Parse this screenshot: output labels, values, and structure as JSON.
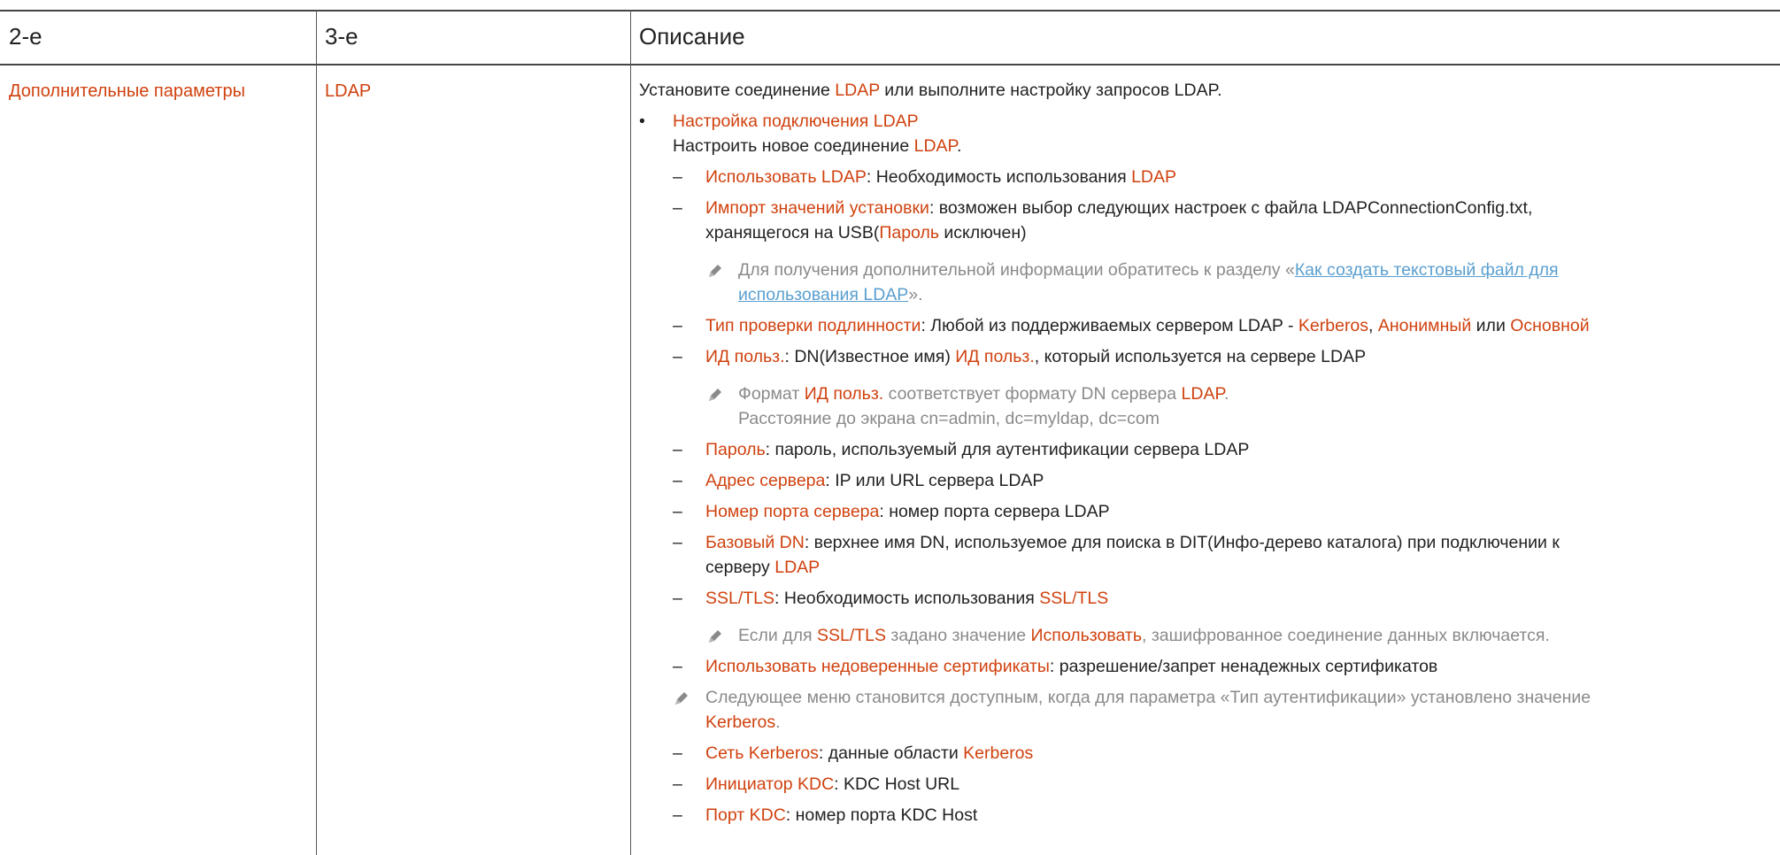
{
  "header": {
    "col2": "2-е",
    "col3": "3-е",
    "col4": "Описание"
  },
  "row": {
    "level2": "Дополнительные параметры",
    "level3": "LDAP",
    "intro": {
      "a": "Установите соединение ",
      "b": "LDAP",
      "c": " или выполните настройку запросов LDAP."
    },
    "bullet": {
      "glyph": "•",
      "title": "Настройка подключения LDAP",
      "sub_a": "Настроить новое соединение ",
      "sub_b": "LDAP",
      "sub_c": "."
    },
    "dash": "–",
    "items": {
      "use_ldap": {
        "a": "Использовать LDAP",
        "b": ": Необходимость использования ",
        "c": "LDAP"
      },
      "import": {
        "a": "Импорт значений установки",
        "b": ": возможен выбор следующих настроек с файла LDAPConnectionConfig.txt,",
        "c": "хранящегося на USB(",
        "d": "Пароль",
        "e": " исключен)"
      },
      "note_import": {
        "a": "Для получения дополнительной информации обратитесь к разделу «",
        "link1": "Как создать текстовый файл для",
        "link2": "использования LDAP",
        "c": "»."
      },
      "auth_type": {
        "a": "Тип проверки подлинности",
        "b": ": Любой из поддерживаемых сервером LDAP - ",
        "c": "Kerberos",
        "d": ", ",
        "e": "Анонимный",
        "f": " или ",
        "g": "Основной"
      },
      "user_id": {
        "a": "ИД польз.",
        "b": ": DN(Известное имя) ",
        "c": "ИД польз.",
        "d": ", который используется на сервере LDAP"
      },
      "note_user": {
        "a": "Формат ",
        "b": "ИД польз.",
        "c": " соответствует формату DN сервера ",
        "d": "LDAP",
        "e": ".",
        "line2": "Расстояние до экрана cn=admin, dc=myldap, dc=com"
      },
      "password": {
        "a": "Пароль",
        "b": ": пароль, используемый для аутентификации сервера LDAP"
      },
      "server_addr": {
        "a": "Адрес сервера",
        "b": ": IP или URL сервера LDAP"
      },
      "server_port": {
        "a": "Номер порта сервера",
        "b": ": номер порта сервера LDAP"
      },
      "base_dn": {
        "a": "Базовый DN",
        "b": ": верхнее имя DN, используемое для поиска в DIT(Инфо-дерево каталога) при подключении к",
        "c": "серверу ",
        "d": "LDAP"
      },
      "ssl": {
        "a": "SSL/TLS",
        "b": ": Необходимость использования ",
        "c": "SSL/TLS"
      },
      "note_ssl": {
        "a": "Если для ",
        "b": "SSL/TLS",
        "c": " задано значение ",
        "d": "Использовать",
        "e": ", зашифрованное соединение данных включается."
      },
      "untrusted": {
        "a": "Использовать недоверенные сертификаты",
        "b": ": разрешение/запрет ненадежных сертификатов"
      },
      "note_kerberos": {
        "a": "Следующее меню становится доступным, когда для параметра «Тип аутентификации» установлено значение",
        "b": "Kerberos",
        "c": "."
      },
      "kerberos_net": {
        "a": "Сеть Kerberos",
        "b": ": данные области ",
        "c": "Kerberos"
      },
      "kdc_init": {
        "a": "Инициатор KDC",
        "b": ": KDC Host URL"
      },
      "kdc_port": {
        "a": "Порт KDC",
        "b": ": номер порта KDC Host"
      }
    }
  },
  "colors": {
    "highlight": "#d0420f",
    "note": "#8a8a8a",
    "link": "#5a9fcf",
    "rule": "#444444"
  },
  "icons": {
    "note": "pencil-icon"
  }
}
